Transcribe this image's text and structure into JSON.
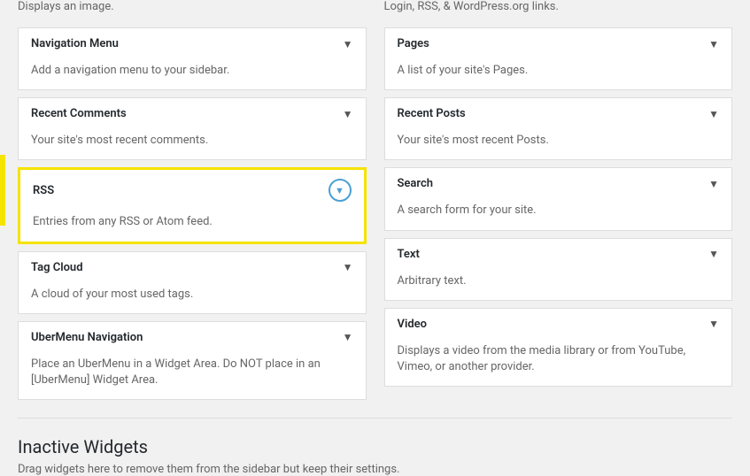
{
  "widgets": {
    "left_column": [
      {
        "id": "navigation-menu",
        "title": "Navigation Menu",
        "desc": "Add a navigation menu to your sidebar.",
        "highlighted": false
      },
      {
        "id": "recent-comments",
        "title": "Recent Comments",
        "desc": "Your site's most recent comments.",
        "highlighted": false
      },
      {
        "id": "rss",
        "title": "RSS",
        "desc": "Entries from any RSS or Atom feed.",
        "highlighted": true
      },
      {
        "id": "tag-cloud",
        "title": "Tag Cloud",
        "desc": "A cloud of your most used tags.",
        "highlighted": false
      },
      {
        "id": "ubermenu-navigation",
        "title": "UberMenu Navigation",
        "desc": "Place an UberMenu in a Widget Area. Do NOT place in an [UberMenu] Widget Area.",
        "highlighted": false
      }
    ],
    "right_column": [
      {
        "id": "pages",
        "title": "Pages",
        "desc": "A list of your site's Pages.",
        "highlighted": false
      },
      {
        "id": "recent-posts",
        "title": "Recent Posts",
        "desc": "Your site's most recent Posts.",
        "highlighted": false
      },
      {
        "id": "search",
        "title": "Search",
        "desc": "A search form for your site.",
        "highlighted": false
      },
      {
        "id": "text",
        "title": "Text",
        "desc": "Arbitrary text.",
        "highlighted": false
      },
      {
        "id": "video",
        "title": "Video",
        "desc": "Displays a video from the media library or from YouTube, Vimeo, or another provider.",
        "highlighted": false
      }
    ]
  },
  "inactive": {
    "title": "Inactive Widgets",
    "desc": "Drag widgets here to remove them from the sidebar but keep their settings."
  },
  "top_row_left_desc": "Displays an image.",
  "top_row_right_desc": "Login, RSS, & WordPress.org links."
}
